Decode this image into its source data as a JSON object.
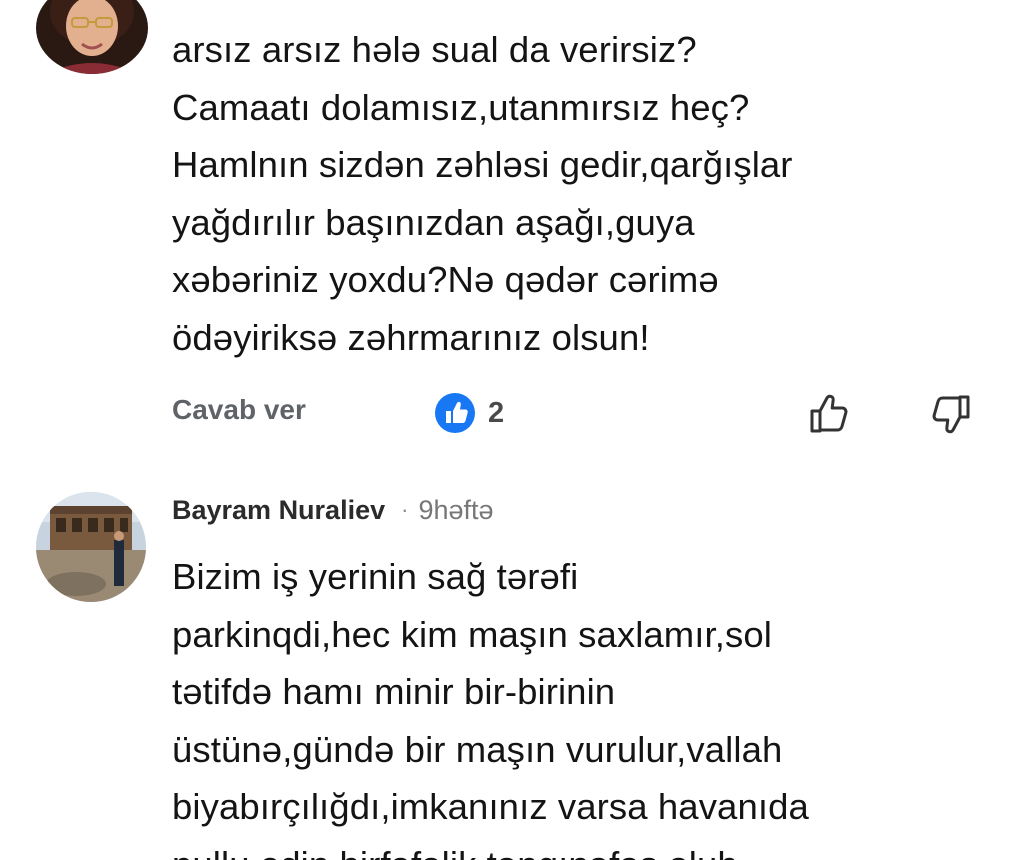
{
  "colors": {
    "background": "#ffffff",
    "text": "#141414",
    "muted": "#5f6368",
    "like_badge_blue": "#1877f2"
  },
  "comment_1": {
    "lines": [
      "arsız arsız hələ sual da verirsiz?",
      "Camaatı dolamısız,utanmırsız heç?",
      "Hamlnın sizdən zəhləsi gedir,qarğışlar",
      "yağdırılır başınızdan aşağı,guya",
      "xəbəriniz yoxdu?Nə qədər cərimə",
      "ödəyiriksə zəhrmarınız olsun!"
    ],
    "actions": {
      "reply_label": "Cavab ver",
      "like_count": "2",
      "like_badge_icon": "thumbs-up-badge-icon",
      "like_icon": "thumbs-up-outline-icon",
      "dislike_icon": "thumbs-down-outline-icon"
    }
  },
  "comment_2": {
    "author": "Bayram Nuraliev",
    "separator": "·",
    "timestamp": "9həftə",
    "lines": [
      "Bizim iş yerinin sağ  tərəfi",
      "parkinqdi,hec kim maşın saxlamır,sol",
      "tətifdə hamı minir bir-birinin",
      "üstünə,gündə bir maşın vurulur,vallah",
      "biyabırçılığdı,imkanınız varsa havanıda",
      "pullu edin,birfəfəlik təngınəfəs oluh"
    ]
  }
}
